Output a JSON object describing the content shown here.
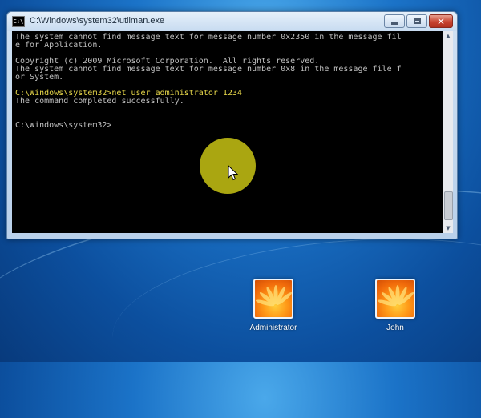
{
  "window": {
    "title": "C:\\Windows\\system32\\utilman.exe",
    "icon_label": "C:\\",
    "close_glyph": "✕"
  },
  "console": {
    "lines": [
      {
        "text": "The system cannot find message text for message number 0x2350 in the message fil",
        "color": "#c0c0c0"
      },
      {
        "text": "e for Application.",
        "color": "#c0c0c0"
      },
      {
        "text": "",
        "color": "#c0c0c0"
      },
      {
        "text": "Copyright (c) 2009 Microsoft Corporation.  All rights reserved.",
        "color": "#c0c0c0"
      },
      {
        "text": "The system cannot find message text for message number 0x8 in the message file f",
        "color": "#c0c0c0"
      },
      {
        "text": "or System.",
        "color": "#c0c0c0"
      },
      {
        "text": "",
        "color": "#c0c0c0"
      },
      {
        "text": "C:\\Windows\\system32>net user administrator 1234",
        "color": "#e8d84a"
      },
      {
        "text": "The command completed successfully.",
        "color": "#c0c0c0"
      },
      {
        "text": "",
        "color": "#c0c0c0"
      },
      {
        "text": "",
        "color": "#c0c0c0"
      },
      {
        "text": "C:\\Windows\\system32>",
        "color": "#c0c0c0"
      }
    ]
  },
  "users": [
    {
      "name": "Administrator"
    },
    {
      "name": "John"
    }
  ],
  "colors": {
    "cursor_highlight": "#c8c314",
    "console_bg": "#000000"
  }
}
